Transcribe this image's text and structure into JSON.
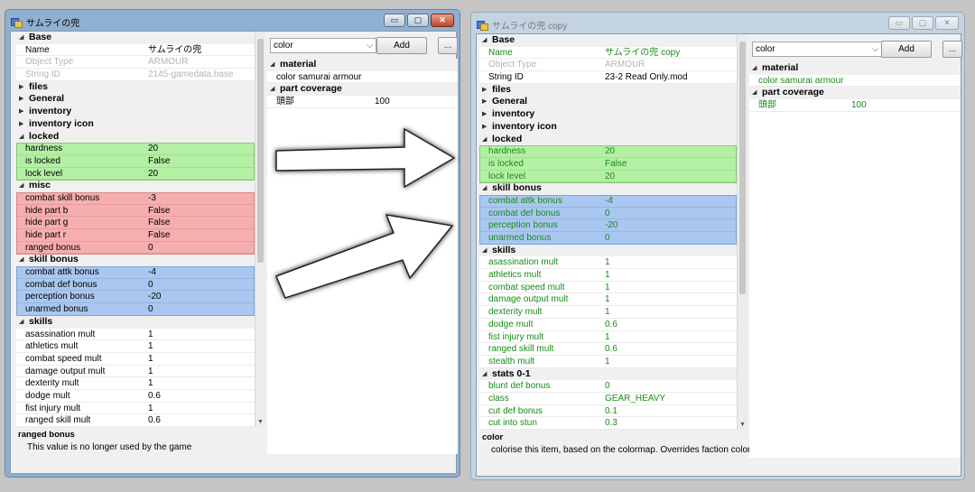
{
  "left_window": {
    "title": "サムライの兜",
    "controls": {
      "minimize": "▭",
      "maximize": "▢",
      "close": "✕"
    },
    "grid_rows": [
      {
        "type": "cat",
        "k": "Base",
        "open": true
      },
      {
        "type": "prop",
        "k": "Name",
        "v": "サムライの兜"
      },
      {
        "type": "prop",
        "k": "Object Type",
        "v": "ARMOUR",
        "style": "dis"
      },
      {
        "type": "prop",
        "k": "String ID",
        "v": "2145-gamedata.base",
        "style": "dis"
      },
      {
        "type": "cat",
        "k": "files",
        "open": false
      },
      {
        "type": "cat",
        "k": "General",
        "open": false
      },
      {
        "type": "cat",
        "k": "inventory",
        "open": false
      },
      {
        "type": "cat",
        "k": "inventory icon",
        "open": false
      },
      {
        "type": "cat",
        "k": "locked",
        "open": true
      },
      {
        "type": "prop",
        "k": "hardness",
        "v": "20",
        "style": "g"
      },
      {
        "type": "prop",
        "k": "is locked",
        "v": "False",
        "style": "g"
      },
      {
        "type": "prop",
        "k": "lock level",
        "v": "20",
        "style": "g"
      },
      {
        "type": "cat",
        "k": "misc",
        "open": true
      },
      {
        "type": "prop",
        "k": "combat skill bonus",
        "v": "-3",
        "style": "r"
      },
      {
        "type": "prop",
        "k": "hide part b",
        "v": "False",
        "style": "r"
      },
      {
        "type": "prop",
        "k": "hide part g",
        "v": "False",
        "style": "r"
      },
      {
        "type": "prop",
        "k": "hide part r",
        "v": "False",
        "style": "r"
      },
      {
        "type": "prop",
        "k": "ranged bonus",
        "v": "0",
        "style": "r"
      },
      {
        "type": "cat",
        "k": "skill bonus",
        "open": true
      },
      {
        "type": "prop",
        "k": "combat attk bonus",
        "v": "-4",
        "style": "b"
      },
      {
        "type": "prop",
        "k": "combat def bonus",
        "v": "0",
        "style": "b"
      },
      {
        "type": "prop",
        "k": "perception bonus",
        "v": "-20",
        "style": "b"
      },
      {
        "type": "prop",
        "k": "unarmed bonus",
        "v": "0",
        "style": "b"
      },
      {
        "type": "cat",
        "k": "skills",
        "open": true
      },
      {
        "type": "prop",
        "k": "asassination mult",
        "v": "1"
      },
      {
        "type": "prop",
        "k": "athletics mult",
        "v": "1"
      },
      {
        "type": "prop",
        "k": "combat speed mult",
        "v": "1"
      },
      {
        "type": "prop",
        "k": "damage output mult",
        "v": "1"
      },
      {
        "type": "prop",
        "k": "dexterity mult",
        "v": "1"
      },
      {
        "type": "prop",
        "k": "dodge mult",
        "v": "0.6"
      },
      {
        "type": "prop",
        "k": "fist injury mult",
        "v": "1"
      },
      {
        "type": "prop",
        "k": "ranged skill mult",
        "v": "0.6"
      }
    ],
    "description": {
      "title": "ranged bonus",
      "text": "This value is no longer used by the game"
    },
    "combo_value": "color",
    "add_label": "Add",
    "more_label": "...",
    "side_rows": [
      {
        "type": "cat",
        "k": "material",
        "open": true
      },
      {
        "type": "prop",
        "k": "color samurai armour",
        "v": ""
      },
      {
        "type": "cat",
        "k": "part coverage",
        "open": true
      },
      {
        "type": "prop",
        "k": "頭部",
        "v": "100"
      }
    ]
  },
  "right_window": {
    "title": "サムライの兜 copy",
    "controls": {
      "minimize": "▭",
      "maximize": "▢",
      "close": "✕"
    },
    "grid_rows": [
      {
        "type": "cat",
        "k": "Base",
        "open": true
      },
      {
        "type": "prop",
        "k": "Name",
        "v": "サムライの兜 copy",
        "style": "grn"
      },
      {
        "type": "prop",
        "k": "Object Type",
        "v": "ARMOUR",
        "style": "dis"
      },
      {
        "type": "prop",
        "k": "String ID",
        "v": "23-2 Read Only.mod"
      },
      {
        "type": "cat",
        "k": "files",
        "open": false
      },
      {
        "type": "cat",
        "k": "General",
        "open": false
      },
      {
        "type": "cat",
        "k": "inventory",
        "open": false
      },
      {
        "type": "cat",
        "k": "inventory icon",
        "open": false
      },
      {
        "type": "cat",
        "k": "locked",
        "open": true
      },
      {
        "type": "prop",
        "k": "hardness",
        "v": "20",
        "style": "g grn"
      },
      {
        "type": "prop",
        "k": "is locked",
        "v": "False",
        "style": "g grn"
      },
      {
        "type": "prop",
        "k": "lock level",
        "v": "20",
        "style": "g grn"
      },
      {
        "type": "cat",
        "k": "skill bonus",
        "open": true
      },
      {
        "type": "prop",
        "k": "combat attk bonus",
        "v": "-4",
        "style": "b grn"
      },
      {
        "type": "prop",
        "k": "combat def bonus",
        "v": "0",
        "style": "b grn"
      },
      {
        "type": "prop",
        "k": "perception bonus",
        "v": "-20",
        "style": "b grn"
      },
      {
        "type": "prop",
        "k": "unarmed bonus",
        "v": "0",
        "style": "b grn"
      },
      {
        "type": "cat",
        "k": "skills",
        "open": true
      },
      {
        "type": "prop",
        "k": "asassination mult",
        "v": "1",
        "style": "grn"
      },
      {
        "type": "prop",
        "k": "athletics mult",
        "v": "1",
        "style": "grn"
      },
      {
        "type": "prop",
        "k": "combat speed mult",
        "v": "1",
        "style": "grn"
      },
      {
        "type": "prop",
        "k": "damage output mult",
        "v": "1",
        "style": "grn"
      },
      {
        "type": "prop",
        "k": "dexterity mult",
        "v": "1",
        "style": "grn"
      },
      {
        "type": "prop",
        "k": "dodge mult",
        "v": "0.6",
        "style": "grn"
      },
      {
        "type": "prop",
        "k": "fist injury mult",
        "v": "1",
        "style": "grn"
      },
      {
        "type": "prop",
        "k": "ranged skill mult",
        "v": "0.6",
        "style": "grn"
      },
      {
        "type": "prop",
        "k": "stealth mult",
        "v": "1",
        "style": "grn"
      },
      {
        "type": "cat",
        "k": "stats 0-1",
        "open": true
      },
      {
        "type": "prop",
        "k": "blunt def bonus",
        "v": "0",
        "style": "grn"
      },
      {
        "type": "prop",
        "k": "class",
        "v": "GEAR_HEAVY",
        "style": "grn"
      },
      {
        "type": "prop",
        "k": "cut def bonus",
        "v": "0.1",
        "style": "grn"
      },
      {
        "type": "prop",
        "k": "cut into stun",
        "v": "0.3",
        "style": "grn"
      }
    ],
    "description": {
      "title": "color",
      "text": "colorise this item, based on the colormap. Overrides faction coloriser."
    },
    "combo_value": "color",
    "add_label": "Add",
    "more_label": "...",
    "side_rows": [
      {
        "type": "cat",
        "k": "material",
        "open": true
      },
      {
        "type": "prop",
        "k": "color samurai armour",
        "v": "",
        "style": "grn"
      },
      {
        "type": "cat",
        "k": "part coverage",
        "open": true
      },
      {
        "type": "prop",
        "k": "頭部",
        "v": "100",
        "style": "grn"
      }
    ]
  },
  "colors": {
    "locked_green": "#b4f0a4",
    "misc_red": "#f7aeae",
    "skill_blue": "#a9c7f0",
    "changed_text": "#1a8a1a"
  },
  "icons": {
    "expand": "triangle-right-icon",
    "collapse": "triangle-down-icon",
    "arrow": "big-white-arrow-icon"
  }
}
